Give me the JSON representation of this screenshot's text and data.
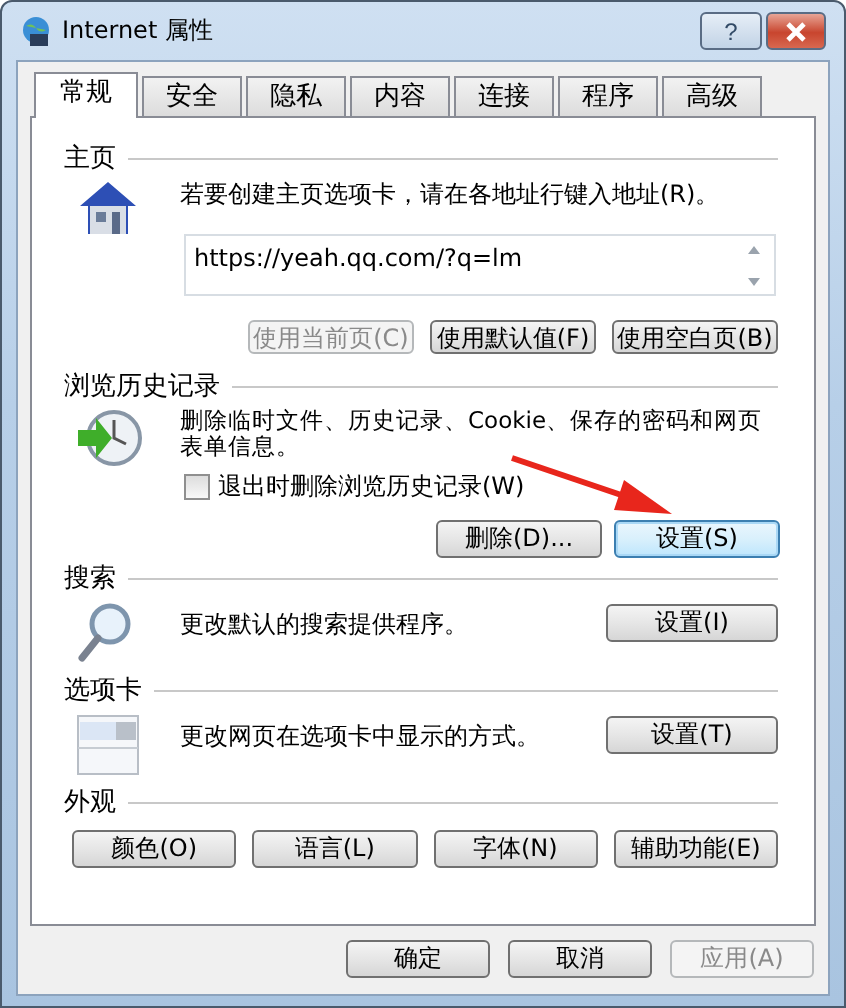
{
  "window": {
    "title": "Internet 属性",
    "help": "?"
  },
  "tabs": [
    {
      "label": "常规",
      "selected": true
    },
    {
      "label": "安全",
      "selected": false
    },
    {
      "label": "隐私",
      "selected": false
    },
    {
      "label": "内容",
      "selected": false
    },
    {
      "label": "连接",
      "selected": false
    },
    {
      "label": "程序",
      "selected": false
    },
    {
      "label": "高级",
      "selected": false
    }
  ],
  "homepage": {
    "title": "主页",
    "description": "若要创建主页选项卡，请在各地址行键入地址(R)。",
    "url": "https://yeah.qq.com/?q=lm",
    "buttons": [
      {
        "label": "使用当前页(C)",
        "disabled": true
      },
      {
        "label": "使用默认值(F)",
        "disabled": false
      },
      {
        "label": "使用空白页(B)",
        "disabled": false
      }
    ]
  },
  "history": {
    "title": "浏览历史记录",
    "description": "删除临时文件、历史记录、Cookie、保存的密码和网页表单信息。",
    "checkbox": {
      "label": "退出时删除浏览历史记录(W)",
      "checked": false
    },
    "buttons": [
      {
        "label": "删除(D)...",
        "focused": false
      },
      {
        "label": "设置(S)",
        "focused": true
      }
    ]
  },
  "search": {
    "title": "搜索",
    "description": "更改默认的搜索提供程序。",
    "button": "设置(I)"
  },
  "tabs_section": {
    "title": "选项卡",
    "description": "更改网页在选项卡中显示的方式。",
    "button": "设置(T)"
  },
  "appearance": {
    "title": "外观",
    "buttons": [
      "颜色(O)",
      "语言(L)",
      "字体(N)",
      "辅助功能(E)"
    ]
  },
  "footer": [
    {
      "label": "确定",
      "disabled": false
    },
    {
      "label": "取消",
      "disabled": false
    },
    {
      "label": "应用(A)",
      "disabled": true
    }
  ]
}
